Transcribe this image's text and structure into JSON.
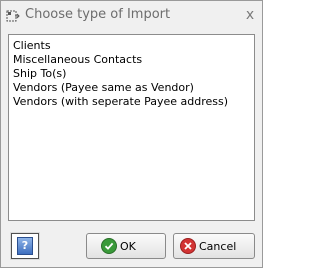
{
  "window": {
    "title": "Choose type of Import",
    "close_symbol": "x",
    "icon": "dialog-icon"
  },
  "import_types": [
    {
      "label": "Clients"
    },
    {
      "label": "Miscellaneous Contacts"
    },
    {
      "label": "Ship To(s)"
    },
    {
      "label": "Vendors (Payee same as Vendor)"
    },
    {
      "label": "Vendors (with seperate Payee address)"
    }
  ],
  "buttons": {
    "help_icon": "help-icon",
    "ok_label": "OK",
    "ok_icon": "checkmark-icon",
    "cancel_label": "Cancel",
    "cancel_icon": "cancel-icon"
  },
  "colors": {
    "ok_icon": "#3a9a3a",
    "cancel_icon": "#d23434",
    "help_icon": "#3f6fbf"
  }
}
